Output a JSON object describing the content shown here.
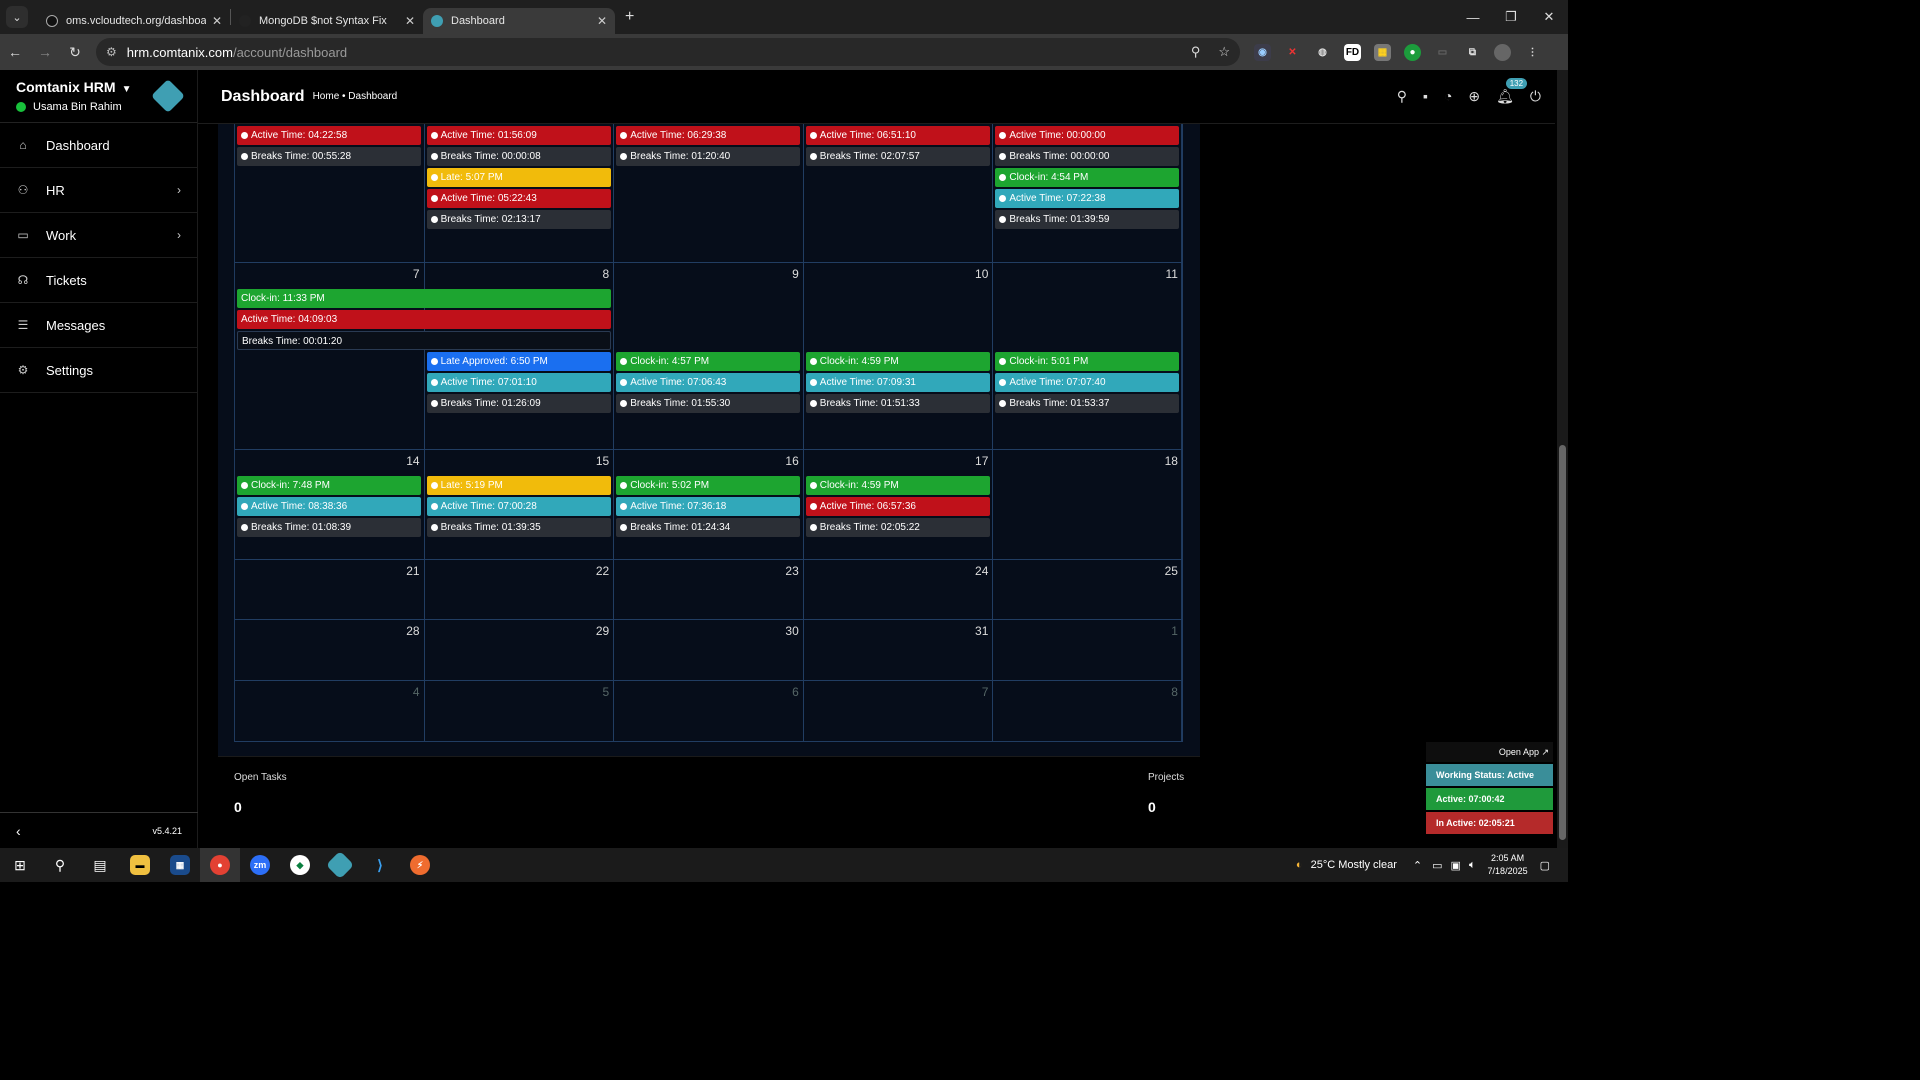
{
  "browser": {
    "tabs": [
      {
        "title": "oms.vcloudtech.org/dashboard",
        "active": false
      },
      {
        "title": "MongoDB $not Syntax Fix",
        "active": false
      },
      {
        "title": "Dashboard",
        "active": true
      }
    ],
    "url_host": "hrm.comtanix.com",
    "url_path": "/account/dashboard"
  },
  "sidebar": {
    "brand": "Comtanix HRM",
    "user": "Usama Bin Rahim",
    "items": [
      {
        "label": "Dashboard",
        "icon": "home-icon"
      },
      {
        "label": "HR",
        "icon": "users-icon"
      },
      {
        "label": "Work",
        "icon": "briefcase-icon"
      },
      {
        "label": "Tickets",
        "icon": "headset-icon"
      },
      {
        "label": "Messages",
        "icon": "message-icon"
      },
      {
        "label": "Settings",
        "icon": "gear-icon"
      }
    ],
    "version": "v5.4.21"
  },
  "header": {
    "title": "Dashboard",
    "breadcrumb": "Home • Dashboard",
    "notification_count": "132"
  },
  "calendar": {
    "weeks": [
      {
        "days": [
          {
            "num": "",
            "events": [
              {
                "type": "red",
                "text": "Active Time: 04:22:58"
              },
              {
                "type": "dark",
                "text": "Breaks Time: 00:55:28"
              }
            ]
          },
          {
            "num": "",
            "events": [
              {
                "type": "red",
                "text": "Active Time: 01:56:09"
              },
              {
                "type": "dark",
                "text": "Breaks Time: 00:00:08"
              },
              {
                "type": "yellow",
                "text": "Late: 5:07 PM"
              },
              {
                "type": "red",
                "text": "Active Time: 05:22:43"
              },
              {
                "type": "dark",
                "text": "Breaks Time: 02:13:17"
              }
            ]
          },
          {
            "num": "",
            "events": [
              {
                "type": "red",
                "text": "Active Time: 06:29:38"
              },
              {
                "type": "dark",
                "text": "Breaks Time: 01:20:40"
              }
            ]
          },
          {
            "num": "",
            "events": [
              {
                "type": "red",
                "text": "Active Time: 06:51:10"
              },
              {
                "type": "dark",
                "text": "Breaks Time: 02:07:57"
              }
            ]
          },
          {
            "num": "",
            "events": [
              {
                "type": "red",
                "text": "Active Time: 00:00:00"
              },
              {
                "type": "dark",
                "text": "Breaks Time: 00:00:00"
              },
              {
                "type": "green",
                "text": "Clock-in: 4:54 PM"
              },
              {
                "type": "teal",
                "text": "Active Time: 07:22:38"
              },
              {
                "type": "dark",
                "text": "Breaks Time: 01:39:59"
              }
            ]
          }
        ]
      },
      {
        "days": [
          {
            "num": "7",
            "events": []
          },
          {
            "num": "8",
            "events": [
              {
                "type": "blue",
                "text": "Late Approved: 6:50 PM"
              },
              {
                "type": "teal",
                "text": "Active Time: 07:01:10"
              },
              {
                "type": "dark",
                "text": "Breaks Time: 01:26:09"
              }
            ]
          },
          {
            "num": "9",
            "events": [
              {
                "type": "green",
                "text": "Clock-in: 4:57 PM"
              },
              {
                "type": "teal",
                "text": "Active Time: 07:06:43"
              },
              {
                "type": "dark",
                "text": "Breaks Time: 01:55:30"
              }
            ]
          },
          {
            "num": "10",
            "events": [
              {
                "type": "green",
                "text": "Clock-in: 4:59 PM"
              },
              {
                "type": "teal",
                "text": "Active Time: 07:09:31"
              },
              {
                "type": "dark",
                "text": "Breaks Time: 01:51:33"
              }
            ]
          },
          {
            "num": "11",
            "events": [
              {
                "type": "green",
                "text": "Clock-in: 5:01 PM"
              },
              {
                "type": "teal",
                "text": "Active Time: 07:07:40"
              },
              {
                "type": "dark",
                "text": "Breaks Time: 01:53:37"
              }
            ]
          }
        ],
        "spanning": [
          {
            "type": "green",
            "text": "Clock-in: 11:33 PM"
          },
          {
            "type": "red",
            "text": "Active Time: 04:09:03"
          },
          {
            "type": "black",
            "text": "Breaks Time: 00:01:20"
          }
        ]
      },
      {
        "days": [
          {
            "num": "14",
            "events": [
              {
                "type": "green",
                "text": "Clock-in: 7:48 PM"
              },
              {
                "type": "teal",
                "text": "Active Time: 08:38:36"
              },
              {
                "type": "dark",
                "text": "Breaks Time: 01:08:39"
              }
            ]
          },
          {
            "num": "15",
            "events": [
              {
                "type": "yellow",
                "text": "Late: 5:19 PM"
              },
              {
                "type": "teal",
                "text": "Active Time: 07:00:28"
              },
              {
                "type": "dark",
                "text": "Breaks Time: 01:39:35"
              }
            ]
          },
          {
            "num": "16",
            "events": [
              {
                "type": "green",
                "text": "Clock-in: 5:02 PM"
              },
              {
                "type": "teal",
                "text": "Active Time: 07:36:18"
              },
              {
                "type": "dark",
                "text": "Breaks Time: 01:24:34"
              }
            ]
          },
          {
            "num": "17",
            "events": [
              {
                "type": "green",
                "text": "Clock-in: 4:59 PM"
              },
              {
                "type": "red",
                "text": "Active Time: 06:57:36"
              },
              {
                "type": "dark",
                "text": "Breaks Time: 02:05:22"
              }
            ]
          },
          {
            "num": "18",
            "events": []
          }
        ]
      },
      {
        "days": [
          {
            "num": "21",
            "events": []
          },
          {
            "num": "22",
            "events": []
          },
          {
            "num": "23",
            "events": []
          },
          {
            "num": "24",
            "events": []
          },
          {
            "num": "25",
            "events": []
          }
        ]
      },
      {
        "days": [
          {
            "num": "28",
            "events": []
          },
          {
            "num": "29",
            "events": []
          },
          {
            "num": "30",
            "events": []
          },
          {
            "num": "31",
            "events": []
          },
          {
            "num": "1",
            "events": [],
            "muted": true
          }
        ]
      },
      {
        "days": [
          {
            "num": "4",
            "events": [],
            "muted": true
          },
          {
            "num": "5",
            "events": [],
            "muted": true
          },
          {
            "num": "6",
            "events": [],
            "muted": true
          },
          {
            "num": "7",
            "events": [],
            "muted": true
          },
          {
            "num": "8",
            "events": [],
            "muted": true
          }
        ]
      }
    ]
  },
  "stats": {
    "open_tasks_label": "Open Tasks",
    "open_tasks_value": "0",
    "projects_label": "Projects",
    "projects_value": "0"
  },
  "widget": {
    "open_app": "Open App ↗",
    "status": "Working Status: Active",
    "active": "Active: 07:00:42",
    "inactive": "In Active: 02:05:21"
  },
  "taskbar": {
    "weather": "25°C  Mostly clear",
    "time": "2:05 AM",
    "date": "7/18/2025"
  },
  "colors": {
    "red": "#c0111a",
    "green": "#1da530",
    "teal": "#31a8ba",
    "yellow": "#f1bb0b",
    "blue": "#1a6ff0",
    "dark": "#2b2f36",
    "accent": "#3f9fb3"
  }
}
